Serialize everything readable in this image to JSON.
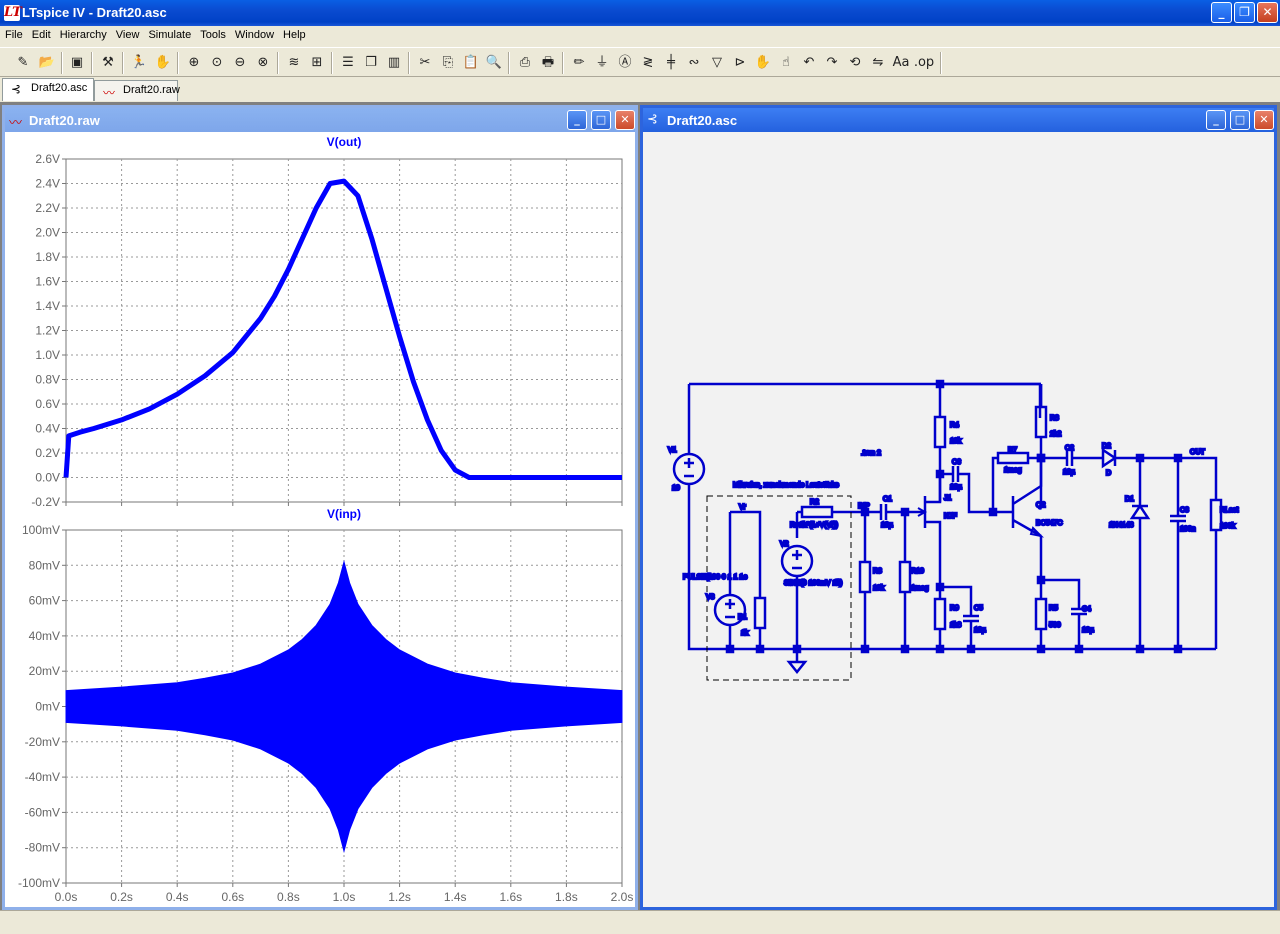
{
  "window": {
    "title": "LTspice IV - Draft20.asc",
    "icon": "ltspice-icon"
  },
  "menu": [
    "File",
    "Edit",
    "Hierarchy",
    "View",
    "Simulate",
    "Tools",
    "Window",
    "Help"
  ],
  "tabs": [
    {
      "label": "Draft20.asc",
      "icon": "schematic-icon",
      "active": true
    },
    {
      "label": "Draft20.raw",
      "icon": "waveform-icon",
      "active": false
    }
  ],
  "waveform_window": {
    "title": "Draft20.raw"
  },
  "schematic_window": {
    "title": "Draft20.asc"
  },
  "chart_data": [
    {
      "type": "line",
      "title": "V(out)",
      "xlabel": "",
      "ylabel": "",
      "x_ticks": [
        "0.0s",
        "0.2s",
        "0.4s",
        "0.6s",
        "0.8s",
        "1.0s",
        "1.2s",
        "1.4s",
        "1.6s",
        "1.8s",
        "2.0s"
      ],
      "y_ticks": [
        "-0.2V",
        "0.0V",
        "0.2V",
        "0.4V",
        "0.6V",
        "0.8V",
        "1.0V",
        "1.2V",
        "1.4V",
        "1.6V",
        "1.8V",
        "2.0V",
        "2.2V",
        "2.4V",
        "2.6V"
      ],
      "xlim": [
        0,
        2.0
      ],
      "ylim": [
        -0.2,
        2.6
      ],
      "grid": true,
      "color": "#0000ff",
      "series": [
        {
          "x": [
            0.0,
            0.01,
            0.05,
            0.1,
            0.2,
            0.3,
            0.4,
            0.5,
            0.6,
            0.7,
            0.75,
            0.8,
            0.85,
            0.9,
            0.95,
            1.0,
            1.05,
            1.1,
            1.15,
            1.2,
            1.25,
            1.3,
            1.35,
            1.4,
            1.45,
            1.5,
            1.6,
            1.8,
            2.0
          ],
          "y": [
            0.0,
            0.34,
            0.37,
            0.4,
            0.47,
            0.56,
            0.68,
            0.83,
            1.02,
            1.3,
            1.48,
            1.7,
            1.95,
            2.2,
            2.4,
            2.42,
            2.3,
            1.95,
            1.55,
            1.15,
            0.78,
            0.47,
            0.22,
            0.06,
            0.0,
            0.0,
            0.0,
            0.0,
            0.0
          ]
        }
      ]
    },
    {
      "type": "area",
      "title": "V(inp)",
      "xlabel": "",
      "ylabel": "",
      "x_ticks": [
        "0.0s",
        "0.2s",
        "0.4s",
        "0.6s",
        "0.8s",
        "1.0s",
        "1.2s",
        "1.4s",
        "1.6s",
        "1.8s",
        "2.0s"
      ],
      "y_ticks": [
        "-100mV",
        "-80mV",
        "-60mV",
        "-40mV",
        "-20mV",
        "0mV",
        "20mV",
        "40mV",
        "60mV",
        "80mV",
        "100mV"
      ],
      "xlim": [
        0,
        2.0
      ],
      "ylim": [
        -100,
        100
      ],
      "grid": true,
      "color": "#0000ff",
      "series": [
        {
          "x": [
            0.0,
            0.2,
            0.4,
            0.5,
            0.6,
            0.7,
            0.8,
            0.85,
            0.9,
            0.95,
            0.98,
            1.0,
            1.02,
            1.05,
            1.1,
            1.15,
            1.2,
            1.3,
            1.4,
            1.5,
            1.6,
            1.8,
            2.0
          ],
          "envelope": [
            9,
            11,
            13.5,
            16,
            19,
            24,
            32,
            38,
            46,
            58,
            70,
            82,
            70,
            58,
            46,
            38,
            32,
            24,
            19,
            16,
            13.5,
            11,
            9
          ]
        }
      ]
    }
  ],
  "schematic": {
    "wire_color": "#0000cc",
    "labels": {
      "v1": "V1",
      "v1_val": "10",
      "tran": ".tran 2",
      "mic_box": "Mikrofon, zunehmende Lautstärke",
      "vr": "Vr",
      "r2": "R2",
      "r2_val": "R=1k*(1+V(Vr))",
      "inp": "INP",
      "c1": "C1",
      "c1_val": "10µ",
      "j1": "J1",
      "j1_val": "NJF",
      "c6": "C6",
      "c6_val": "10µ",
      "r4": "R4",
      "r4_val": "10k",
      "r8": "R8",
      "r8_val": "2k2",
      "r7": "R7",
      "r7_val": "1meg",
      "c2": "C2",
      "c2_val": "10µ",
      "d2": "D2",
      "d2_val": "D",
      "out": "OUT",
      "q2": "Q2",
      "q2_val": "BC547C",
      "d1": "D1",
      "d1_val": "1N4148",
      "c3": "C3",
      "c3_val": "100n",
      "rlast": "RLast",
      "rlast_val": "100k",
      "v2": "V2",
      "v2_val": "SINE(0 100mV 1k)",
      "v3": "V3",
      "v3_val": "PULSE(100 0 1 1 1e",
      "r1": "R1",
      "r1_val": "1k",
      "r3": "R3",
      "r3_val": "10k",
      "r10": "R10",
      "r10_val": "1meg",
      "r9": "R9",
      "r9_val": "1k8",
      "c5": "C5",
      "c5_val": "10µ",
      "r5": "R5",
      "r5_val": "560",
      "c4": "C4",
      "c4_val": "10µ"
    }
  }
}
